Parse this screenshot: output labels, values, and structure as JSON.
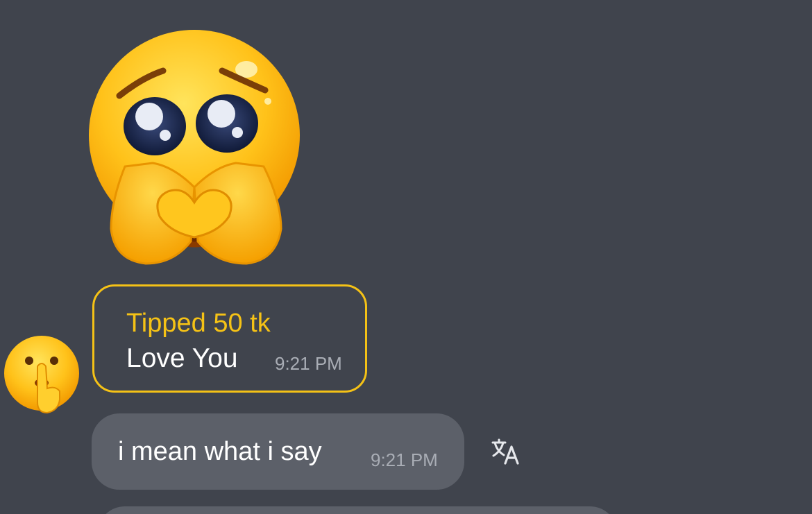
{
  "sticker": {
    "icon": "pleading-face-heart-hands-icon"
  },
  "tip_message": {
    "title": "Tipped 50 tk",
    "message": "Love You",
    "time": "9:21 PM",
    "accent_color": "#f5c216"
  },
  "avatar": {
    "icon": "shushing-face-icon"
  },
  "text_message": {
    "text": "i mean what i say",
    "time": "9:21 PM"
  },
  "translate": {
    "icon": "translate-icon"
  },
  "colors": {
    "background": "#40444d",
    "bubble": "#5c6069",
    "time_text": "#a9adb5"
  }
}
